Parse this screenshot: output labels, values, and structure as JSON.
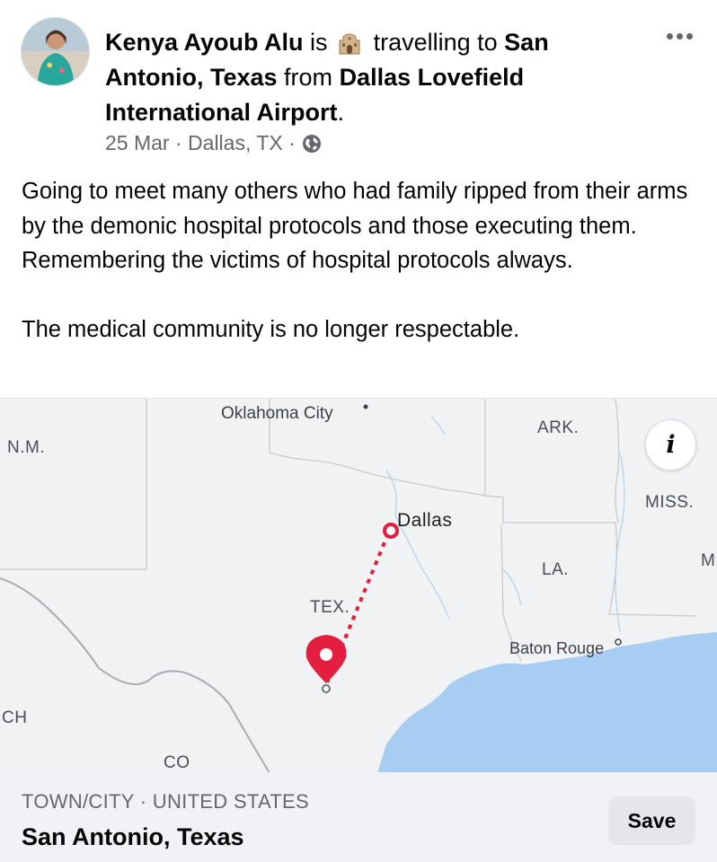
{
  "post": {
    "author": "Kenya Ayoub Alu",
    "verb_is": "is",
    "activity": "travelling to",
    "destination": "San Antonio, Texas",
    "from_word": "from",
    "origin": "Dallas Lovefield International Airport",
    "period": ".",
    "date": "25 Mar",
    "location": "Dallas, TX",
    "separator": "·",
    "privacy_icon": "globe-icon",
    "activity_icon": "alamo-building-icon",
    "body_paragraphs": [
      "Going to meet many others who had family ripped from their arms by the demonic hospital protocols and those executing them. Remembering the victims of hospital protocols always.",
      "The medical community is no longer respectable."
    ]
  },
  "map": {
    "labels": {
      "oklahoma_city": "Oklahoma City",
      "nm": "N.M.",
      "ark": "ARK.",
      "miss": "MISS.",
      "dallas": "Dallas",
      "la": "LA.",
      "tex": "TEX.",
      "baton_rouge": "Baton Rouge",
      "m": "M",
      "ch": "CH",
      "co": "CO"
    },
    "info_label": "i",
    "colors": {
      "route": "#e41e3f",
      "water": "#a8cdf2",
      "land": "#f1f2f3",
      "border": "#a9acb0"
    }
  },
  "footer": {
    "place_type": "TOWN/CITY · UNITED STATES",
    "place_name": "San Antonio, Texas",
    "save_label": "Save"
  }
}
